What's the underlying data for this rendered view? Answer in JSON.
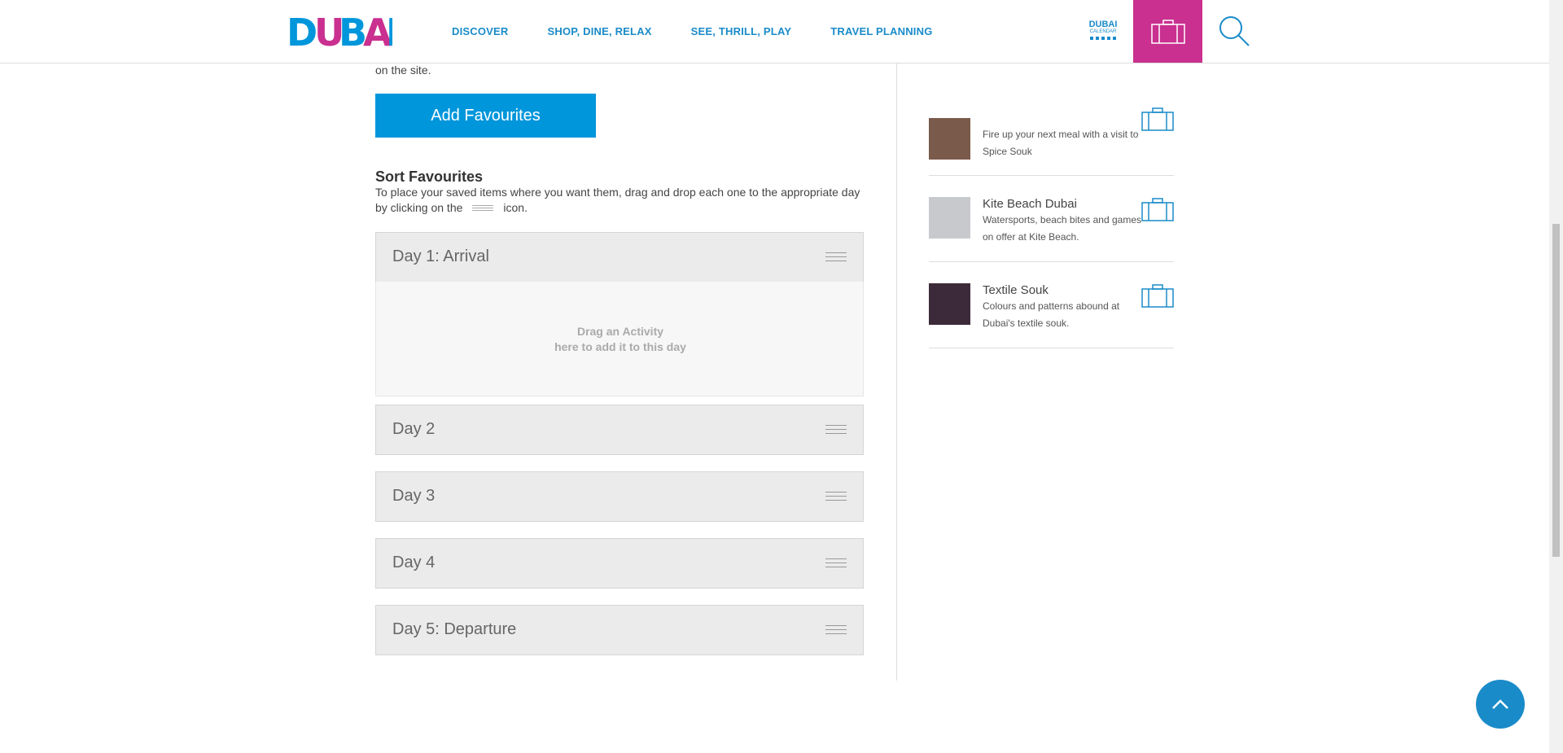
{
  "header": {
    "logo_alt": "DUBAI",
    "nav": [
      "DISCOVER",
      "SHOP, DINE, RELAX",
      "SEE, THRILL, PLAY",
      "TRAVEL PLANNING"
    ],
    "calendar": {
      "title": "DUBAI",
      "subtitle": "CALENDAR"
    },
    "accent_color": "#c9308f",
    "brand_color": "#1a8bc9"
  },
  "main": {
    "intro_tail": "on the site.",
    "add_favourites_label": "Add Favourites",
    "sort_title": "Sort Favourites",
    "sort_desc_before": "To place your saved items where you want them, drag and drop each one to the appropriate day by clicking on the",
    "sort_desc_after": "icon.",
    "days": [
      {
        "label": "Day 1: Arrival"
      },
      {
        "label": "Day 2"
      },
      {
        "label": "Day 3"
      },
      {
        "label": "Day 4"
      },
      {
        "label": "Day 5: Departure"
      }
    ],
    "dropzone": {
      "line1": "Drag an Activity",
      "line2": "here to add it to this day"
    }
  },
  "sidebar": {
    "items": [
      {
        "title": "",
        "desc": "Fire up your next meal with a visit to Spice Souk",
        "thumb_color": "#7a5a4a"
      },
      {
        "title": "Kite Beach Dubai",
        "desc": "Watersports, beach bites and games on offer at Kite Beach.",
        "thumb_color": "#c8c9cc"
      },
      {
        "title": "Textile Souk",
        "desc": "Colours and patterns abound at Dubai's textile souk.",
        "thumb_color": "#3c2a3a"
      }
    ]
  }
}
